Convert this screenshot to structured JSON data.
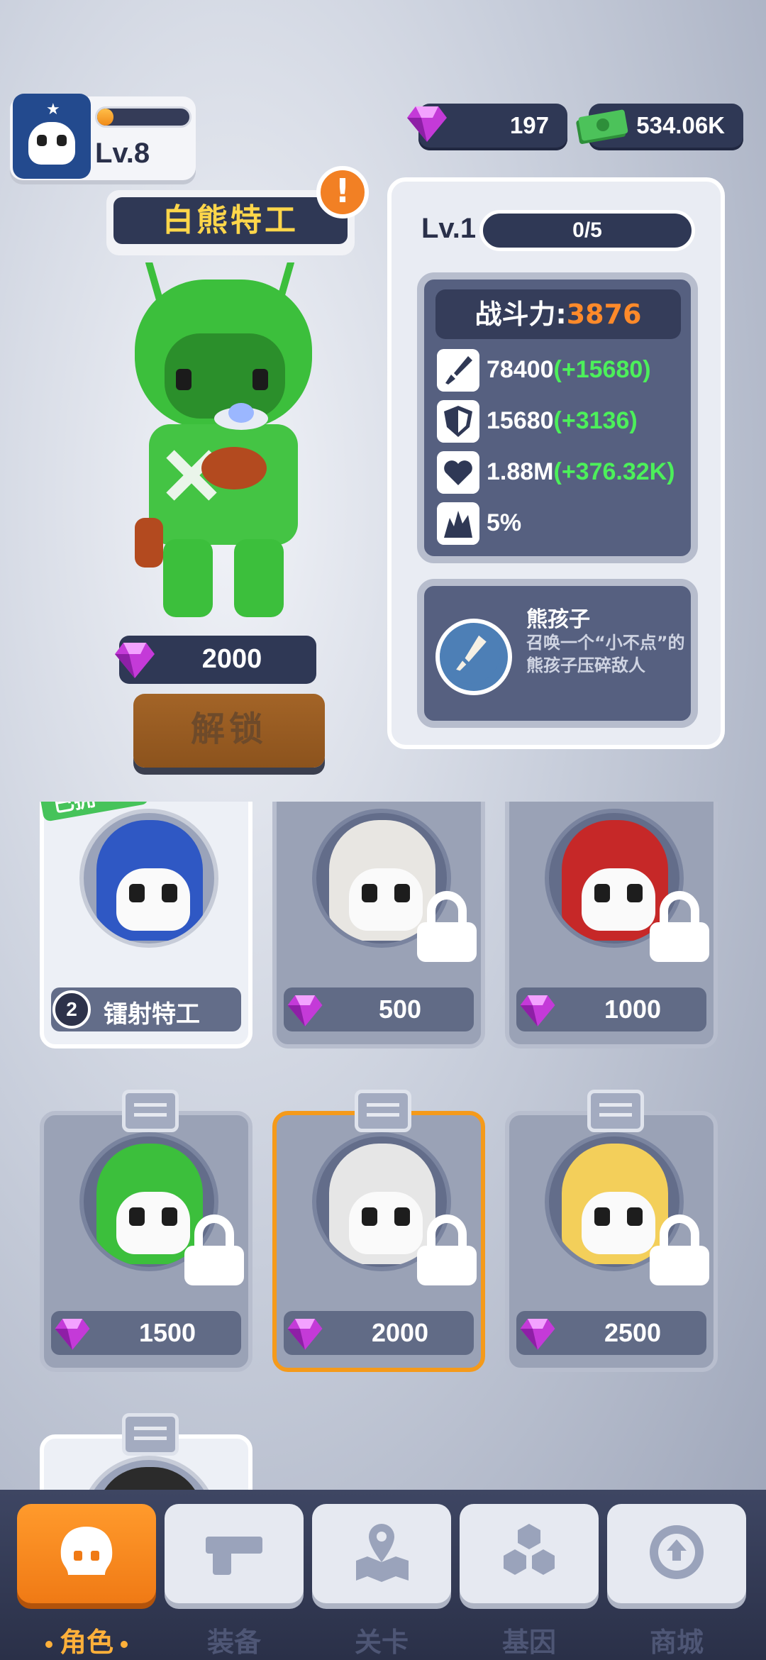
{
  "player": {
    "level": "Lv.8",
    "xp_fraction": 0.18
  },
  "currency": {
    "gems": "197",
    "cash": "534.06K"
  },
  "character": {
    "name": "白熊特工",
    "alert": "!",
    "unlock_price": "2000",
    "unlock_label": "解锁"
  },
  "stats_panel": {
    "level": "Lv.1",
    "progress": "0/5",
    "power_label": "战斗力:",
    "power_value": "3876",
    "stats": [
      {
        "icon": "attack-icon",
        "value": "78400",
        "bonus": "(+15680)"
      },
      {
        "icon": "shield-icon",
        "value": "15680",
        "bonus": "(+3136)"
      },
      {
        "icon": "heart-icon",
        "value": "1.88M",
        "bonus": "(+376.32K)"
      },
      {
        "icon": "crit-icon",
        "value": "5%",
        "bonus": ""
      }
    ],
    "skill": {
      "name": "熊孩子",
      "description": "召唤一个“小不点”的熊孩子压碎敌人"
    }
  },
  "roster": [
    {
      "name": "镭射特工",
      "number": "2",
      "owned": true,
      "hood_color": "#2f58c4",
      "ribbon": "已拥"
    },
    {
      "price": "500",
      "owned": false,
      "hood_color": "#e8e6e2"
    },
    {
      "price": "1000",
      "owned": false,
      "hood_color": "#c62828"
    },
    {
      "price": "1500",
      "owned": false,
      "hood_color": "#3cbf3c"
    },
    {
      "price": "2000",
      "owned": false,
      "hood_color": "#e6e6e6",
      "selected": true
    },
    {
      "price": "2500",
      "owned": false,
      "hood_color": "#f3cf5a"
    },
    {
      "owned": false,
      "hood_color": "#2b2b2b"
    }
  ],
  "nav": [
    {
      "label": "角色",
      "icon": "skull-icon",
      "active": true
    },
    {
      "label": "装备",
      "icon": "gun-icon"
    },
    {
      "label": "关卡",
      "icon": "map-pin-icon"
    },
    {
      "label": "基因",
      "icon": "hexagons-icon"
    },
    {
      "label": "商城",
      "icon": "shop-icon"
    }
  ],
  "colors": {
    "accent": "#f28024",
    "panel_dark": "#2f3855",
    "bonus_green": "#4cf05a",
    "power_orange": "#ff8a2a"
  }
}
